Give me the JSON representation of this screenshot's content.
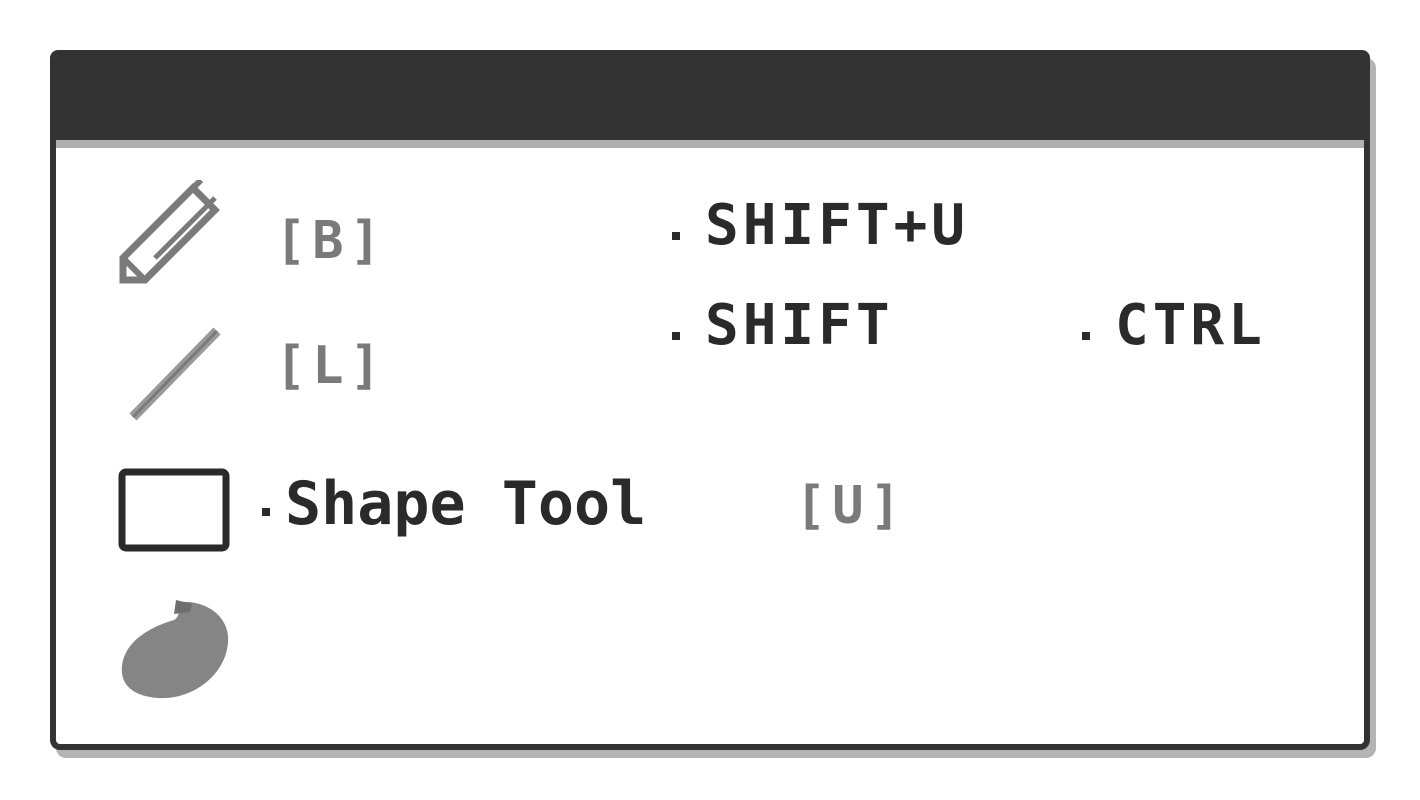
{
  "tools": [
    {
      "icon": "pencil-icon",
      "shortcut": "[B]"
    },
    {
      "icon": "line-icon",
      "shortcut": "[L]"
    },
    {
      "icon": "rectangle-icon",
      "label": "Shape Tool",
      "shortcut": "[U]"
    },
    {
      "icon": "blob-icon"
    }
  ],
  "modifiers": {
    "shift_u": "SHIFT+U",
    "shift": "SHIFT",
    "ctrl": "CTRL"
  },
  "colors": {
    "frame": "#333333",
    "text": "#2a2a2a",
    "shortcut": "#7a7a7a",
    "shadow": "#b4b4b4"
  }
}
